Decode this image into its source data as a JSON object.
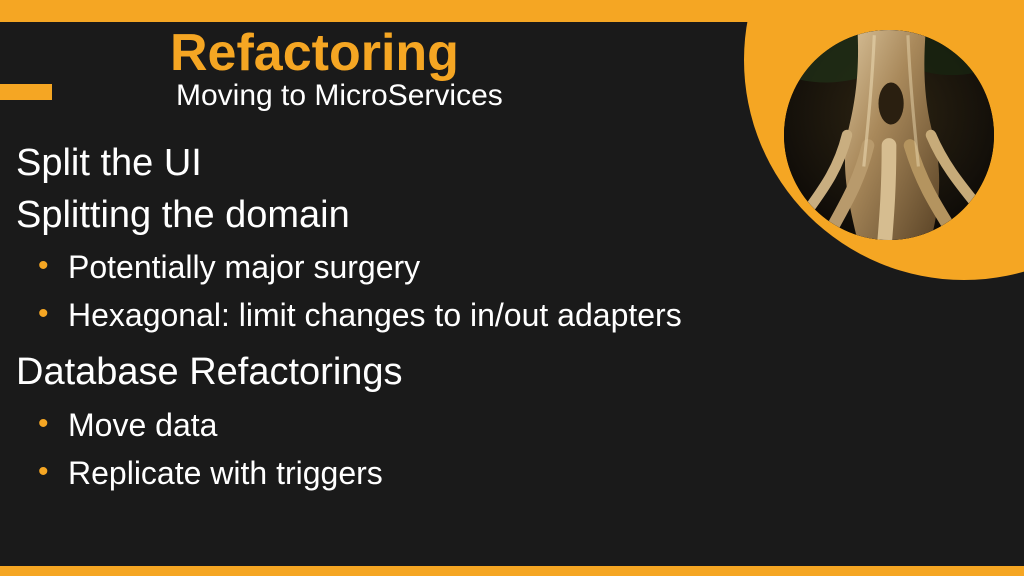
{
  "colors": {
    "accent": "#f5a623",
    "background": "#1a1a1a",
    "text": "#ffffff"
  },
  "header": {
    "title": "Refactoring",
    "subtitle": "Moving to MicroServices"
  },
  "content": {
    "sections": [
      {
        "heading": "Split the UI",
        "bullets": []
      },
      {
        "heading": "Splitting the domain",
        "bullets": [
          "Potentially major surgery",
          "Hexagonal: limit changes to in/out adapters"
        ]
      },
      {
        "heading": "Database Refactorings",
        "bullets": [
          "Move data",
          "Replicate with triggers"
        ]
      }
    ]
  },
  "image": {
    "name": "tree-roots-image",
    "alt": "Tree trunk with intertwined roots"
  }
}
